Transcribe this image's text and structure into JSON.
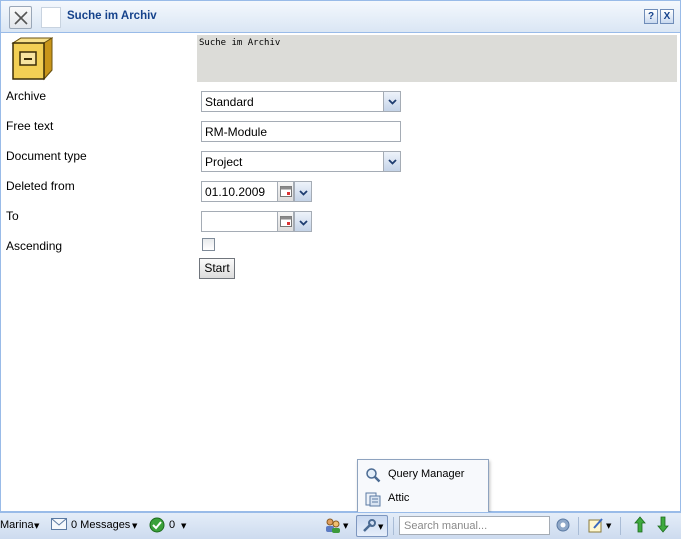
{
  "window": {
    "title": "Suche im Archiv",
    "help_label": "?",
    "close_label": "X"
  },
  "header": {
    "text": "Suche im Archiv"
  },
  "form": {
    "archive": {
      "label": "Archive",
      "value": "Standard"
    },
    "free_text": {
      "label": "Free text",
      "value": "RM-Module"
    },
    "document_type": {
      "label": "Document type",
      "value": "Project"
    },
    "deleted_from": {
      "label": "Deleted from",
      "value": "01.10.2009"
    },
    "to": {
      "label": "To",
      "value": ""
    },
    "ascending": {
      "label": "Ascending",
      "checked": false
    },
    "start_label": "Start"
  },
  "popup_menu": {
    "items": [
      {
        "label": "Query Manager",
        "icon": "magnifier-icon"
      },
      {
        "label": "Attic",
        "icon": "attic-icon"
      }
    ]
  },
  "statusbar": {
    "user": "Marina",
    "messages": "0 Messages",
    "tasks_count": "0",
    "search_placeholder": "Search manual..."
  }
}
